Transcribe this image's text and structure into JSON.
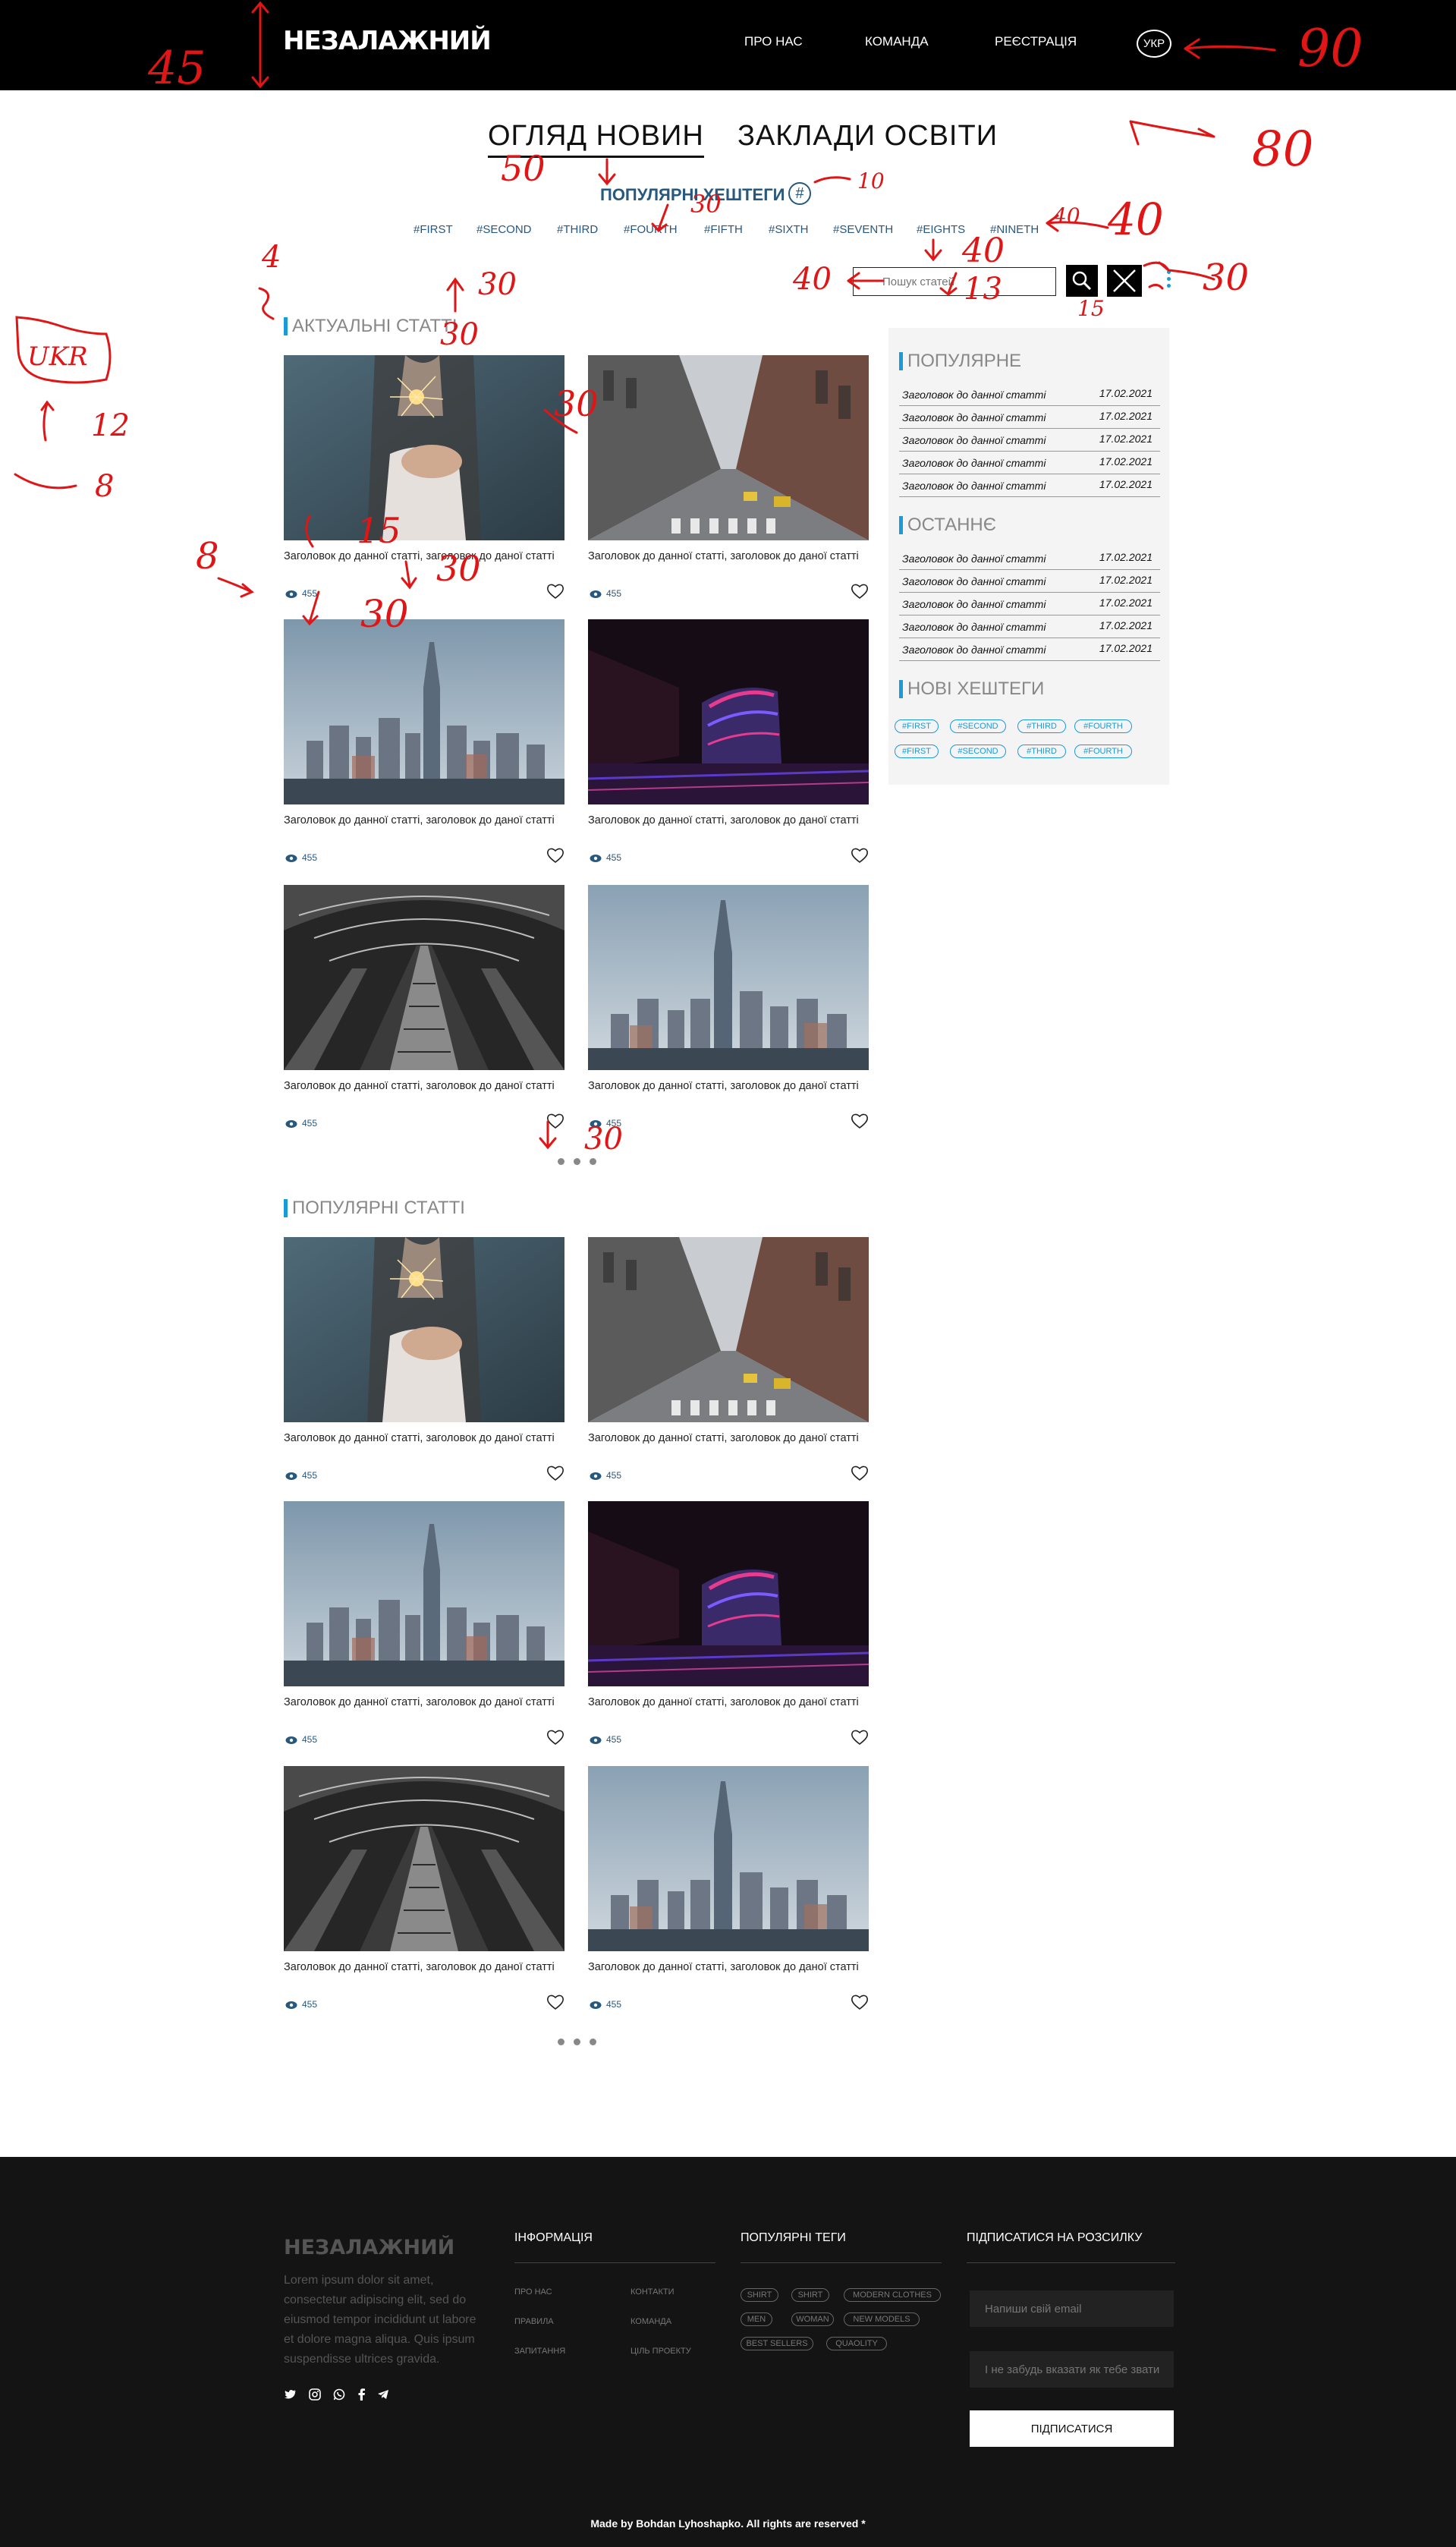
{
  "header": {
    "logo": "НЕЗАЛАЖНИЙ",
    "nav": [
      "ПРО НАС",
      "КОМАНДА",
      "РЕЄСТРАЦІЯ"
    ],
    "lang": "УКР"
  },
  "tabs": [
    "ОГЛЯД НОВИН",
    "ЗАКЛАДИ ОСВІТИ"
  ],
  "popular_tags": {
    "title": "ПОПУЛЯРНІ ХЕШТЕГИ",
    "icon": "#",
    "items": [
      "#FIRST",
      "#SECOND",
      "#THIRD",
      "#FOURTH",
      "#FIFTH",
      "#SIXTH",
      "#SEVENTH",
      "#EIGHTS",
      "#NINETH"
    ]
  },
  "search": {
    "placeholder": "Пошук статей"
  },
  "sections": {
    "current": "АКТУАЛЬНІ СТАТТІ",
    "popular": "ПОПУЛЯРНІ СТАТТІ"
  },
  "card": {
    "title": "Заголовок до данної статті, заголовок до даної статті",
    "views": "455"
  },
  "sidebar": {
    "popular_title": "ПОПУЛЯРНЕ",
    "latest_title": "ОСТАННЄ",
    "new_tags_title": "НОВІ ХЕШТЕГИ",
    "row_title": "Заголовок до данної статті",
    "row_date": "17.02.2021",
    "tags": [
      "#FIRST",
      "#SECOND",
      "#THIRD",
      "#FOURTH"
    ]
  },
  "footer": {
    "logo": "НЕЗАЛАЖНИЙ",
    "description": "Lorem ipsum dolor sit amet, consectetur adipiscing elit, sed do eiusmod tempor incididunt ut labore et dolore magna aliqua. Quis ipsum suspendisse ultrices gravida.",
    "info_title": "ІНФОРМАЦІЯ",
    "info_links": [
      "ПРО НАС",
      "ПРАВИЛА",
      "ЗАПИТАННЯ",
      "КОНТАКТИ",
      "КОМАНДА",
      "ЦІЛЬ ПРОЕКТУ"
    ],
    "tags_title": "ПОПУЛЯРНІ ТЕГИ",
    "tags": [
      "SHIRT",
      "SHIRT",
      "MODERN CLOTHES",
      "MEN",
      "WOMAN",
      "NEW MODELS",
      "BEST SELLERS",
      "QUAOLITY"
    ],
    "subscribe_title": "ПІДПИСАТИСЯ НА РОЗСИЛКУ",
    "email_placeholder": "Напиши свій email",
    "name_placeholder": "І не забудь вказати як тебе звати",
    "subscribe_button": "ПІДПИСАТИСЯ",
    "copyright": "Made by Bohdan Lyhoshapko. All rights are reserved *"
  },
  "annotations": [
    "45",
    "90",
    "80",
    "50",
    "10",
    "30",
    "4",
    "30",
    "30",
    "UKR",
    "12",
    "8",
    "40",
    "40",
    "13",
    "40",
    "15",
    "30",
    "8",
    "15",
    "30",
    "30",
    "30",
    "30",
    "40"
  ],
  "colors": {
    "accent": "#1a9bd7",
    "tag_blue": "#27587f",
    "header_bg": "#000000",
    "footer_bg": "#141414",
    "annotation_red": "#e01515"
  }
}
